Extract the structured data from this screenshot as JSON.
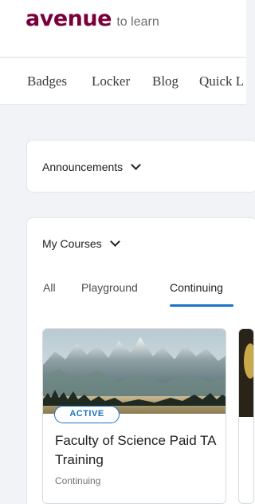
{
  "logo": {
    "main": "avenue",
    "sub": "to learn"
  },
  "nav": {
    "items": [
      "Badges",
      "Locker",
      "Blog",
      "Quick L"
    ]
  },
  "announcements": {
    "title": "Announcements"
  },
  "my_courses": {
    "title": "My Courses",
    "tabs": [
      "All",
      "Playground",
      "Continuing"
    ],
    "active_tab": "Continuing",
    "courses": [
      {
        "status": "ACTIVE",
        "title": "Faculty of Science Paid TA Training",
        "subtitle": "Continuing"
      }
    ]
  },
  "colors": {
    "brand": "#7a003c",
    "accent": "#1a73c4",
    "background": "#f1f3f6"
  }
}
